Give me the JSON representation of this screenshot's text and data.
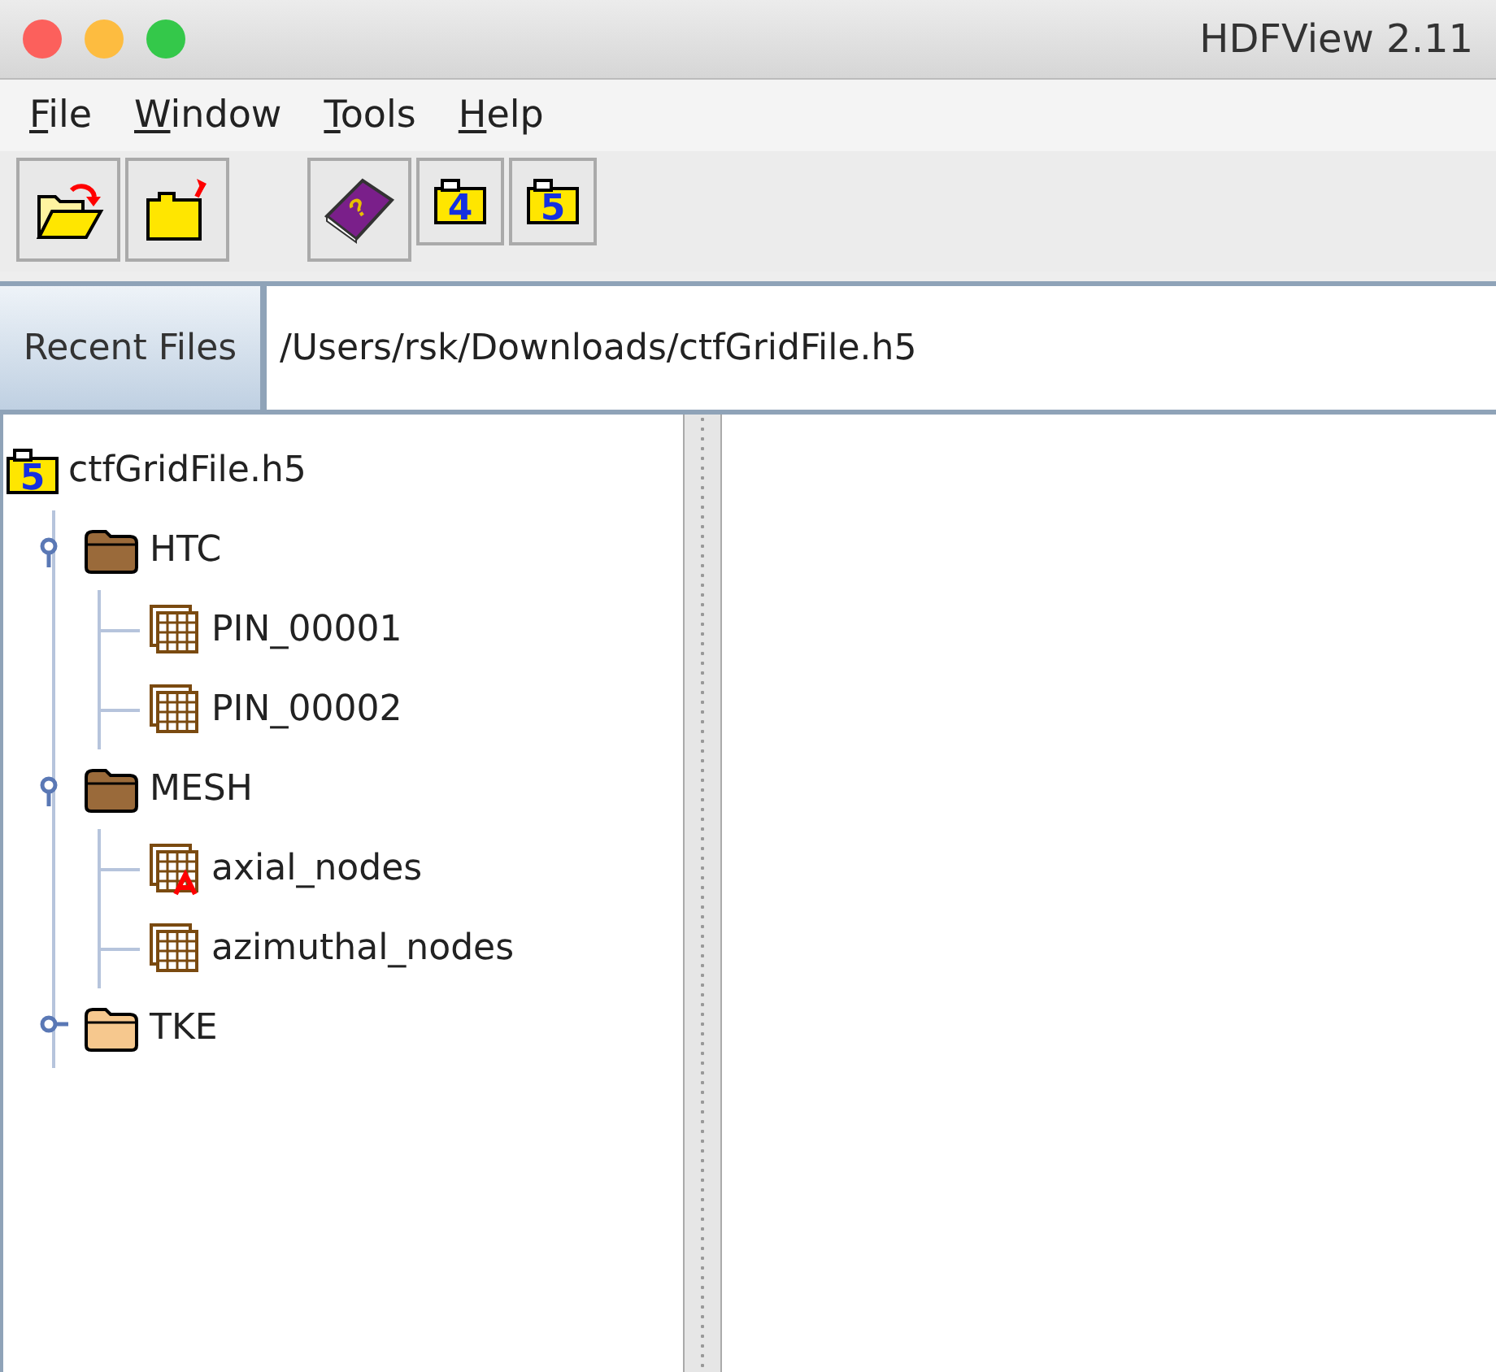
{
  "window": {
    "title": "HDFView 2.11"
  },
  "menu": [
    "File",
    "Window",
    "Tools",
    "Help"
  ],
  "toolbar": [
    {
      "kind": "open"
    },
    {
      "kind": "close"
    },
    {
      "kind": "help",
      "label": "?"
    },
    {
      "kind": "hdf4",
      "label": "4"
    },
    {
      "kind": "hdf5",
      "label": "5"
    }
  ],
  "recent_files": {
    "label": "Recent Files",
    "value": "/Users/rsk/Downloads/ctfGridFile.h5"
  },
  "tree": {
    "name": "ctfGridFile.h5",
    "badge": "5",
    "children": [
      {
        "name": "HTC",
        "expanded": true,
        "children": [
          {
            "kind": "dataset",
            "name": "PIN_00001"
          },
          {
            "kind": "dataset",
            "name": "PIN_00002"
          }
        ]
      },
      {
        "name": "MESH",
        "expanded": true,
        "children": [
          {
            "kind": "text_dataset",
            "name": "axial_nodes"
          },
          {
            "kind": "dataset",
            "name": "azimuthal_nodes"
          }
        ]
      },
      {
        "name": "TKE",
        "expanded": false
      }
    ]
  }
}
